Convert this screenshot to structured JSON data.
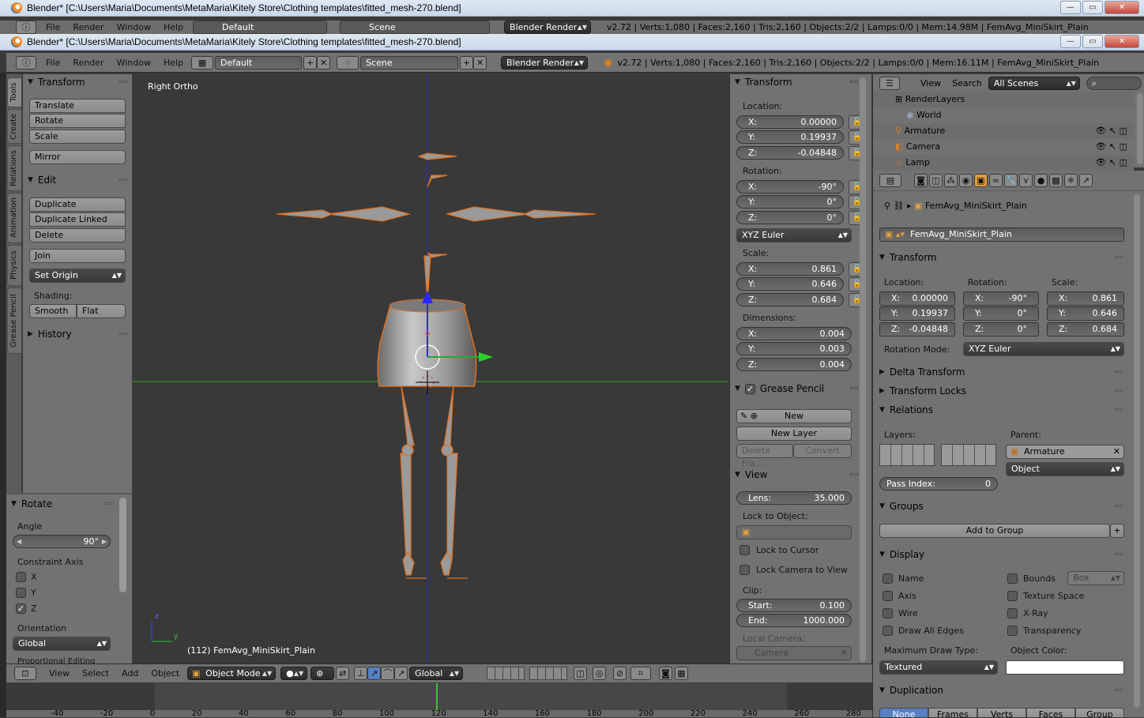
{
  "window": {
    "title": "Blender* [C:\\Users\\Maria\\Documents\\MetaMaria\\Kitely Store\\Clothing templates\\fitted_mesh-270.blend]",
    "minimize": "—",
    "maximize": "▭",
    "close": "✕"
  },
  "header_back": {
    "menus": [
      "File",
      "Render",
      "Window",
      "Help"
    ],
    "layout": "Default",
    "scene": "Scene",
    "engine": "Blender Render",
    "stats": "v2.72 | Verts:1,080 | Faces:2,160 | Tris:2,160 | Objects:2/2 | Lamps:0/0 | Mem:14.98M | FemAvg_MiniSkirt_Plain"
  },
  "header": {
    "menus": [
      "File",
      "Render",
      "Window",
      "Help"
    ],
    "layout": "Default",
    "scene": "Scene",
    "engine": "Blender Render",
    "stats": "v2.72 | Verts:1,080 | Faces:2,160 | Tris:2,160 | Objects:2/2 | Lamps:0/0 | Mem:16.11M | FemAvg_MiniSkirt_Plain"
  },
  "tool_tabs": [
    "Tools",
    "Create",
    "Relations",
    "Animation",
    "Physics",
    "Grease Pencil"
  ],
  "tools": {
    "transform_title": "Transform",
    "translate": "Translate",
    "rotate": "Rotate",
    "scale": "Scale",
    "mirror": "Mirror",
    "edit_title": "Edit",
    "duplicate": "Duplicate",
    "duplicate_linked": "Duplicate Linked",
    "delete": "Delete",
    "join": "Join",
    "set_origin": "Set Origin",
    "shading_label": "Shading:",
    "smooth": "Smooth",
    "flat": "Flat",
    "history_title": "History"
  },
  "operator": {
    "title": "Rotate",
    "angle_label": "Angle",
    "angle_value": "90°",
    "constraint_label": "Constraint Axis",
    "axis_x": "X",
    "axis_y": "Y",
    "axis_z": "Z",
    "axis_z_checked": true,
    "orientation_label": "Orientation",
    "orientation_value": "Global",
    "proportional_label": "Proportional Editing"
  },
  "viewport": {
    "view_name": "Right Ortho",
    "object_label": "(112) FemAvg_MiniSkirt_Plain",
    "axis_z": "z",
    "axis_y": "y"
  },
  "npanel": {
    "transform_title": "Transform",
    "location_label": "Location:",
    "location": {
      "x": "0.00000",
      "y": "0.19937",
      "z": "-0.04848"
    },
    "rotation_label": "Rotation:",
    "rotation": {
      "x": "-90°",
      "y": "0°",
      "z": "0°"
    },
    "rotation_mode": "XYZ Euler",
    "scale_label": "Scale:",
    "scale": {
      "x": "0.861",
      "y": "0.646",
      "z": "0.684"
    },
    "dimensions_label": "Dimensions:",
    "dimensions": {
      "x": "0.004",
      "y": "0.003",
      "z": "0.004"
    },
    "grease_title": "Grease Pencil",
    "new": "New",
    "new_layer": "New Layer",
    "delete_frame": "Delete Fra...",
    "convert": "Convert",
    "view_title": "View",
    "lens_label": "Lens:",
    "lens_value": "35.000",
    "lock_object_label": "Lock to Object:",
    "lock_cursor": "Lock to Cursor",
    "lock_camera": "Lock Camera to View",
    "clip_label": "Clip:",
    "clip_start_label": "Start:",
    "clip_start": "0.100",
    "clip_end_label": "End:",
    "clip_end": "1000.000",
    "local_camera_label": "Local Camera:",
    "local_camera": "Camera",
    "axis": {
      "x": "X:",
      "y": "Y:",
      "z": "Z:"
    }
  },
  "outliner": {
    "view": "View",
    "search": "Search",
    "scenes": "All Scenes",
    "items": [
      "RenderLayers",
      "World",
      "Armature",
      "Camera",
      "Lamp"
    ]
  },
  "properties": {
    "object_path": "FemAvg_MiniSkirt_Plain",
    "object_name": "FemAvg_MiniSkirt_Plain",
    "transform_title": "Transform",
    "location_label": "Location:",
    "rotation_label": "Rotation:",
    "scale_label": "Scale:",
    "loc": {
      "x": "0.00000",
      "y": "0.19937",
      "z": "-0.04848"
    },
    "rot": {
      "x": "-90°",
      "y": "0°",
      "z": "0°"
    },
    "scl": {
      "x": "0.861",
      "y": "0.646",
      "z": "0.684"
    },
    "rotation_mode_label": "Rotation Mode:",
    "rotation_mode": "XYZ Euler",
    "delta_transform": "Delta Transform",
    "transform_locks": "Transform Locks",
    "relations": "Relations",
    "layers_label": "Layers:",
    "parent_label": "Parent:",
    "parent": "Armature",
    "parent_type": "Object",
    "pass_index_label": "Pass Index:",
    "pass_index": "0",
    "groups": "Groups",
    "add_to_group": "Add to Group",
    "display": "Display",
    "name": "Name",
    "axis": "Axis",
    "wire": "Wire",
    "draw_all_edges": "Draw All Edges",
    "bounds": "Bounds",
    "bounds_type": "Box",
    "texture_space": "Texture Space",
    "xray": "X-Ray",
    "transparency": "Transparency",
    "max_draw_label": "Maximum Draw Type:",
    "max_draw": "Textured",
    "object_color_label": "Object Color:",
    "duplication": "Duplication",
    "dup_modes": [
      "None",
      "Frames",
      "Verts",
      "Faces",
      "Group"
    ],
    "xyz": {
      "x": "X:",
      "y": "Y:",
      "z": "Z:"
    }
  },
  "view_header": {
    "menus": [
      "View",
      "Select",
      "Add",
      "Object"
    ],
    "mode": "Object Mode",
    "orientation": "Global"
  },
  "timeline": {
    "ticks": [
      "-40",
      "-20",
      "0",
      "20",
      "40",
      "60",
      "80",
      "100",
      "120",
      "140",
      "160",
      "180",
      "200",
      "220",
      "240",
      "260",
      "280"
    ],
    "current_frame": 112
  }
}
